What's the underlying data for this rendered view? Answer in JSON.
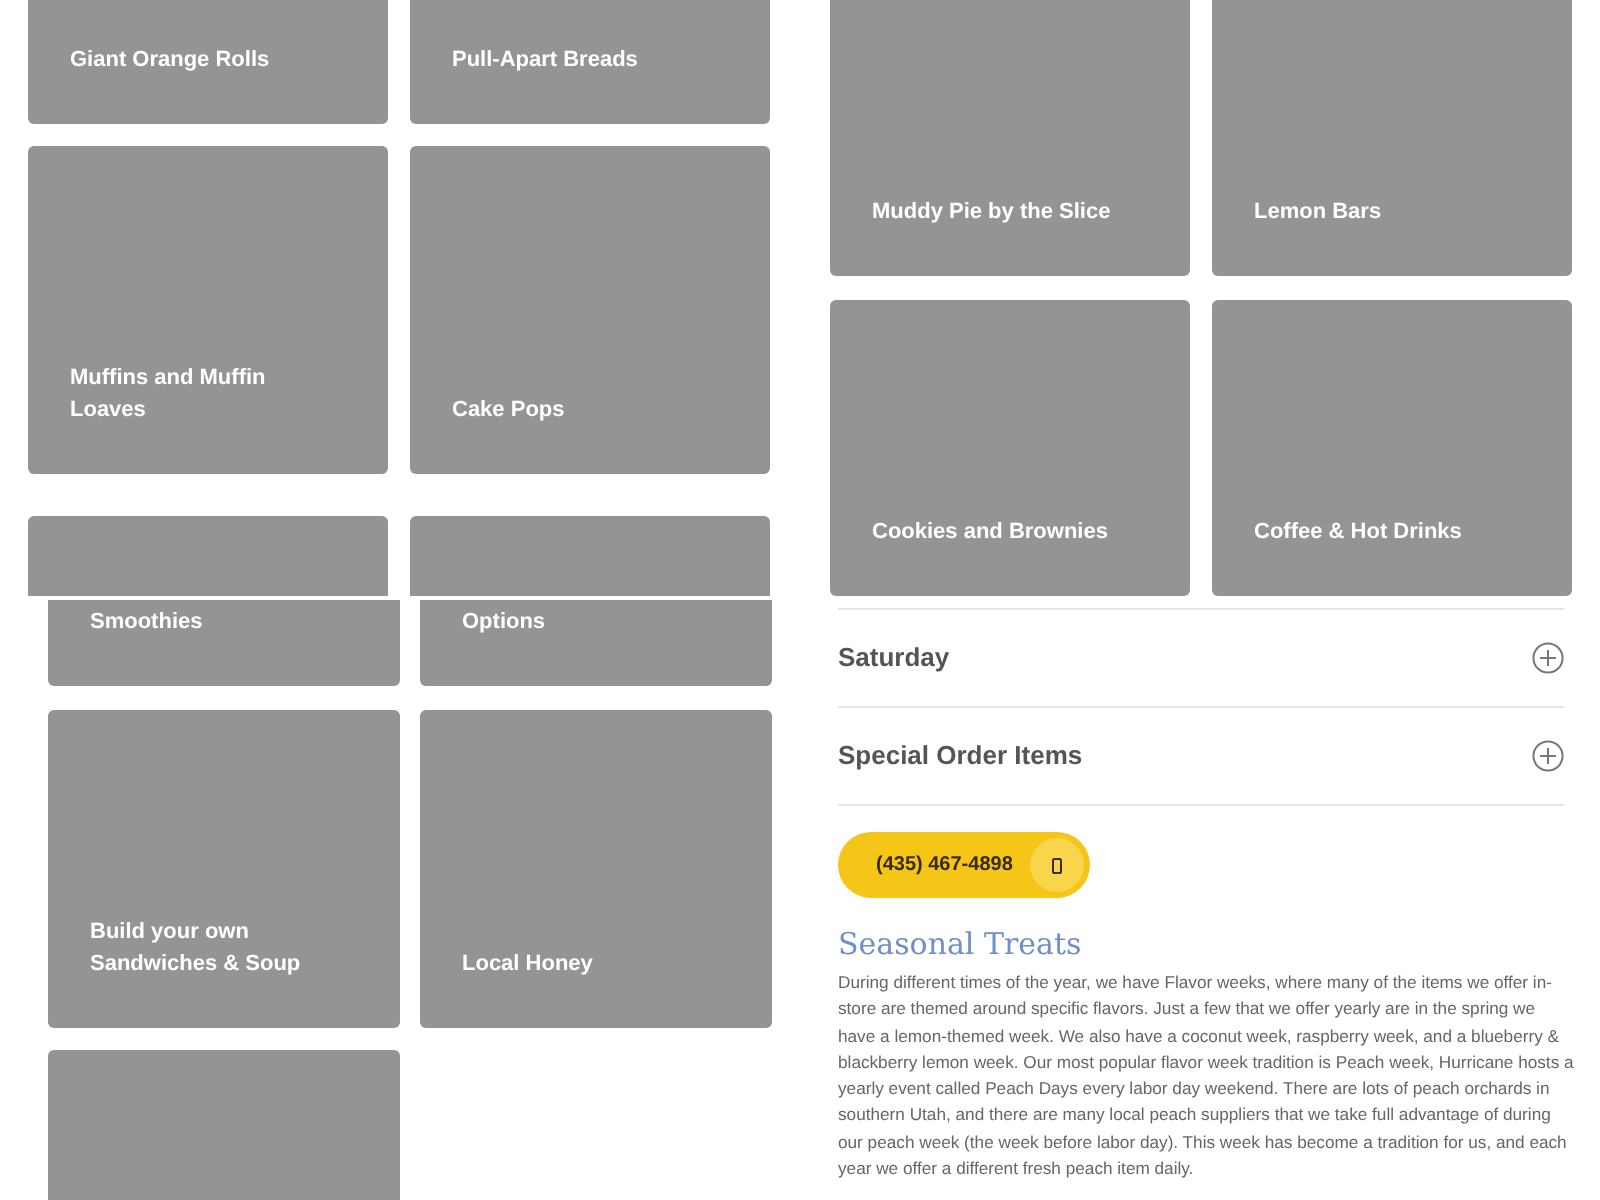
{
  "left_tiles_upper": [
    [
      {
        "label": "Giant Orange Rolls"
      },
      {
        "label": "Pull-Apart Breads"
      }
    ],
    [
      {
        "label": "Muffins and Muffin Loaves"
      },
      {
        "label": "Cake Pops"
      }
    ]
  ],
  "left_tiles_lower": [
    [
      {
        "label": "Smoothies"
      },
      {
        "label": "Options"
      }
    ],
    [
      {
        "label": "Build your own Sandwiches & Soup"
      },
      {
        "label": "Local Honey"
      }
    ]
  ],
  "right_tiles": [
    [
      {
        "label": "Muddy Pie by the Slice"
      },
      {
        "label": "Lemon Bars"
      }
    ],
    [
      {
        "label": "Cookies and Brownies"
      },
      {
        "label": "Coffee & Hot Drinks"
      }
    ]
  ],
  "accordion": [
    {
      "title": "Saturday",
      "expanded": false
    },
    {
      "title": "Special Order Items",
      "expanded": false
    }
  ],
  "phone_button": {
    "label": "(435) 467-4898"
  },
  "seasonal": {
    "heading": "Seasonal Treats",
    "text": "During different times of the year, we have Flavor weeks, where many of the items we offer in-store are themed around specific flavors. Just a few that we offer yearly are in the spring we have a lemon-themed week. We also have a coconut week, raspberry week, and a blueberry & blackberry lemon week. Our most popular flavor week tradition is Peach week, Hurricane hosts a yearly event called Peach Days every labor day weekend. There are lots of peach orchards in southern Utah, and there are many local peach suppliers that we take full advantage of during our peach week (the week before labor day). This week has become a tradition for us, and each year we offer a different fresh peach item daily."
  }
}
